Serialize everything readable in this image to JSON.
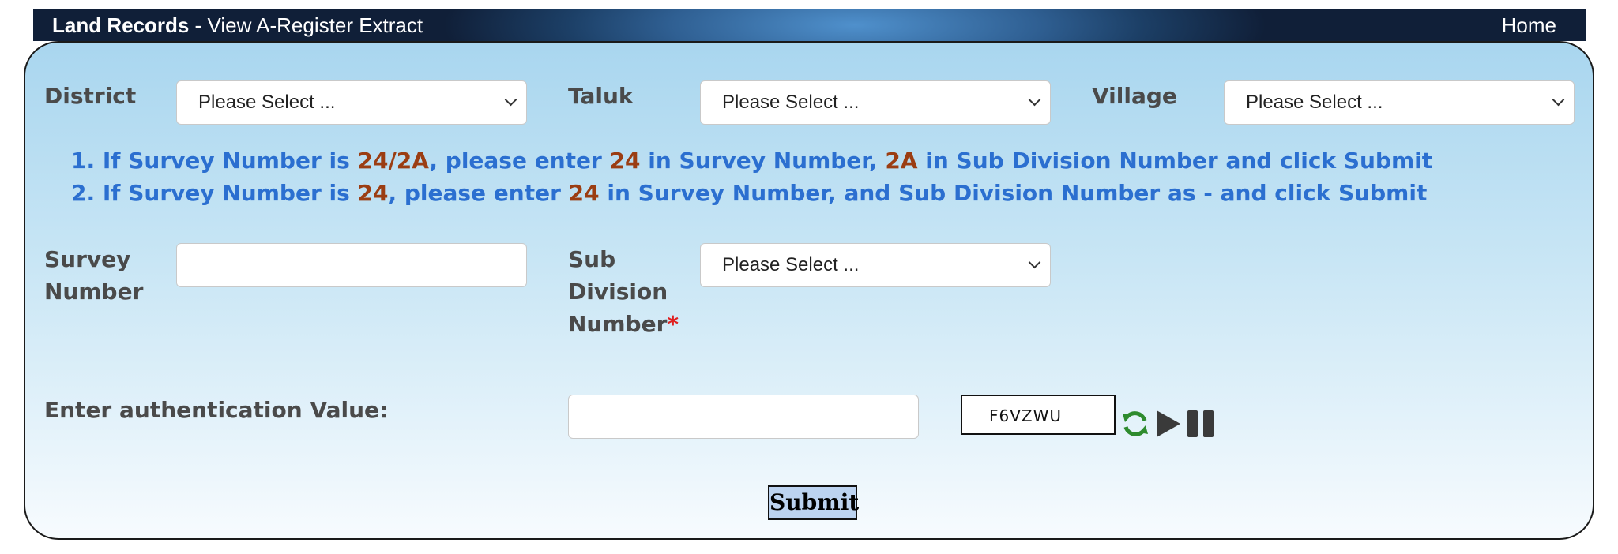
{
  "header": {
    "title_bold": "Land Records - ",
    "title_rest": "View A-Register Extract",
    "home_link": "Home"
  },
  "form": {
    "district": {
      "label": "District",
      "value": "Please Select ..."
    },
    "taluk": {
      "label": "Taluk",
      "value": "Please Select ..."
    },
    "village": {
      "label": "Village",
      "value": "Please Select ..."
    },
    "survey_number": {
      "label_line1": "Survey",
      "label_line2": "Number",
      "value": ""
    },
    "sub_division": {
      "label_line1": "Sub",
      "label_line2": "Division",
      "label_line3": "Number",
      "required_mark": "*",
      "value": "Please Select ..."
    },
    "auth": {
      "label": "Enter authentication Value:",
      "value": "",
      "captcha_text": "F6VZWU"
    },
    "submit_label": "Submit"
  },
  "instructions": [
    {
      "prefix": "1. If Survey Number is ",
      "hl1": "24/2A",
      "mid1": ", please enter ",
      "hl2": "24",
      "mid2": " in Survey Number, ",
      "hl3": "2A",
      "suffix": " in Sub Division Number and click Submit"
    },
    {
      "prefix": "2. If Survey Number is ",
      "hl1": "24",
      "mid1": ", please enter ",
      "hl2": "24",
      "suffix": " in Survey Number, and Sub Division Number as - and click Submit"
    }
  ],
  "colors": {
    "instruction_text": "#2b6fd0",
    "instruction_highlight": "#9b3d12",
    "label_text": "#4a4a4a",
    "refresh_icon": "#2e8b2e",
    "submit_bg": "#bcd3f0"
  },
  "icons": [
    "refresh-icon",
    "play-icon",
    "pause-icon",
    "chevron-down-icon"
  ]
}
